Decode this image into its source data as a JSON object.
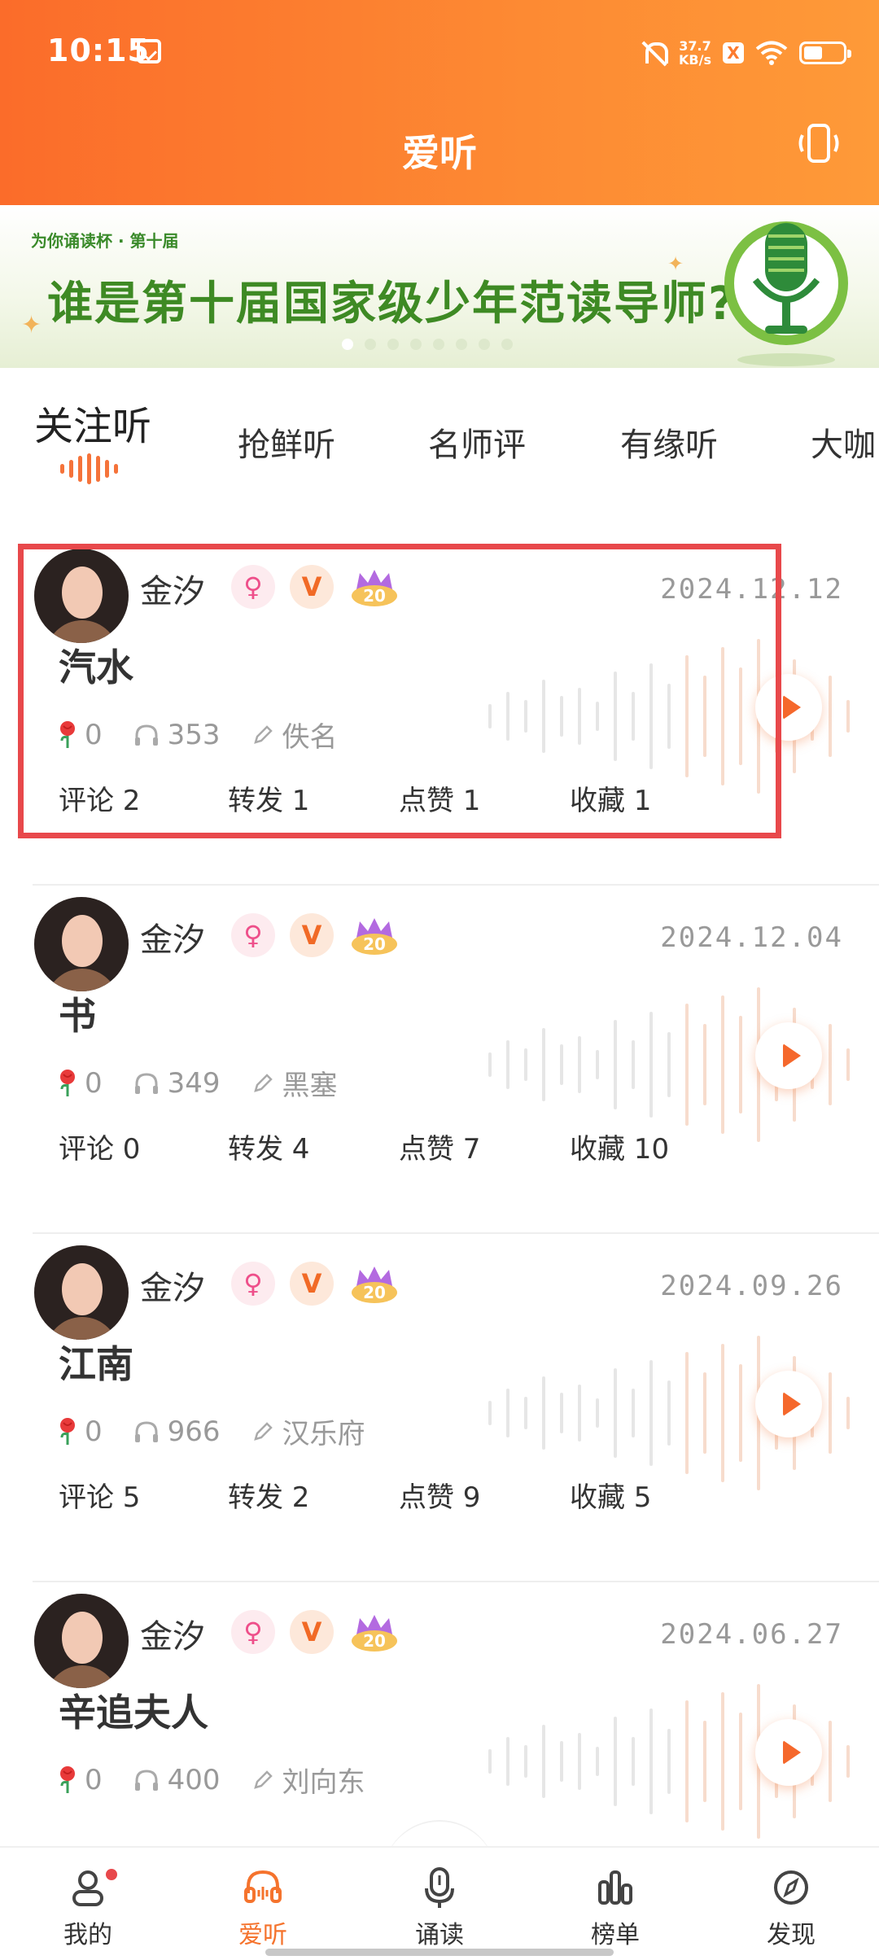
{
  "status_bar": {
    "time": "10:15",
    "net_speed_top": "37.7",
    "net_speed_unit": "KB/s",
    "x_label": "X",
    "icons": [
      "sim-icon",
      "mute-icon",
      "x-icon",
      "wifi-icon",
      "battery-icon"
    ]
  },
  "header": {
    "title": "爱听",
    "shake_icon": "phone-shake-icon"
  },
  "banner": {
    "small_text": "为你诵读杯 · 第十届",
    "main_text": "谁是第十届国家级少年范读导师?"
  },
  "tabs": [
    {
      "label": "关注听",
      "active": true
    },
    {
      "label": "抢鲜听",
      "active": false
    },
    {
      "label": "名师评",
      "active": false
    },
    {
      "label": "有缘听",
      "active": false
    },
    {
      "label": "大咖",
      "active": false
    }
  ],
  "posts": [
    {
      "author": "金汐",
      "date": "2024.12.12",
      "title": "汽水",
      "roses": "0",
      "listens": "353",
      "writer": "佚名",
      "comments": "评论 2",
      "reposts": "转发 1",
      "likes": "点赞 1",
      "favorites": "收藏 1",
      "highlighted": true
    },
    {
      "author": "金汐",
      "date": "2024.12.04",
      "title": "书",
      "roses": "0",
      "listens": "349",
      "writer": "黑塞",
      "comments": "评论 0",
      "reposts": "转发 4",
      "likes": "点赞 7",
      "favorites": "收藏 10"
    },
    {
      "author": "金汐",
      "date": "2024.09.26",
      "title": "江南",
      "roses": "0",
      "listens": "966",
      "writer": "汉乐府",
      "comments": "评论 5",
      "reposts": "转发 2",
      "likes": "点赞 9",
      "favorites": "收藏 5"
    },
    {
      "author": "金汐",
      "date": "2024.06.27",
      "title": "辛追夫人",
      "roses": "0",
      "listens": "400",
      "writer": "刘向东"
    }
  ],
  "badges": {
    "female": "♀",
    "vip": "V",
    "level_badge": "20"
  },
  "bottom_nav": [
    {
      "label": "我的",
      "icon": "person-icon",
      "active": false,
      "has_dot": true
    },
    {
      "label": "爱听",
      "icon": "headphones-icon",
      "active": true
    },
    {
      "label": "诵读",
      "icon": "microphone-icon",
      "active": false
    },
    {
      "label": "榜单",
      "icon": "ranking-bars-icon",
      "active": false
    },
    {
      "label": "发现",
      "icon": "compass-icon",
      "active": false
    }
  ],
  "colors": {
    "brand": "#fd7a2e",
    "highlight_box": "#e8484b",
    "banner_green": "#3e8a24"
  }
}
